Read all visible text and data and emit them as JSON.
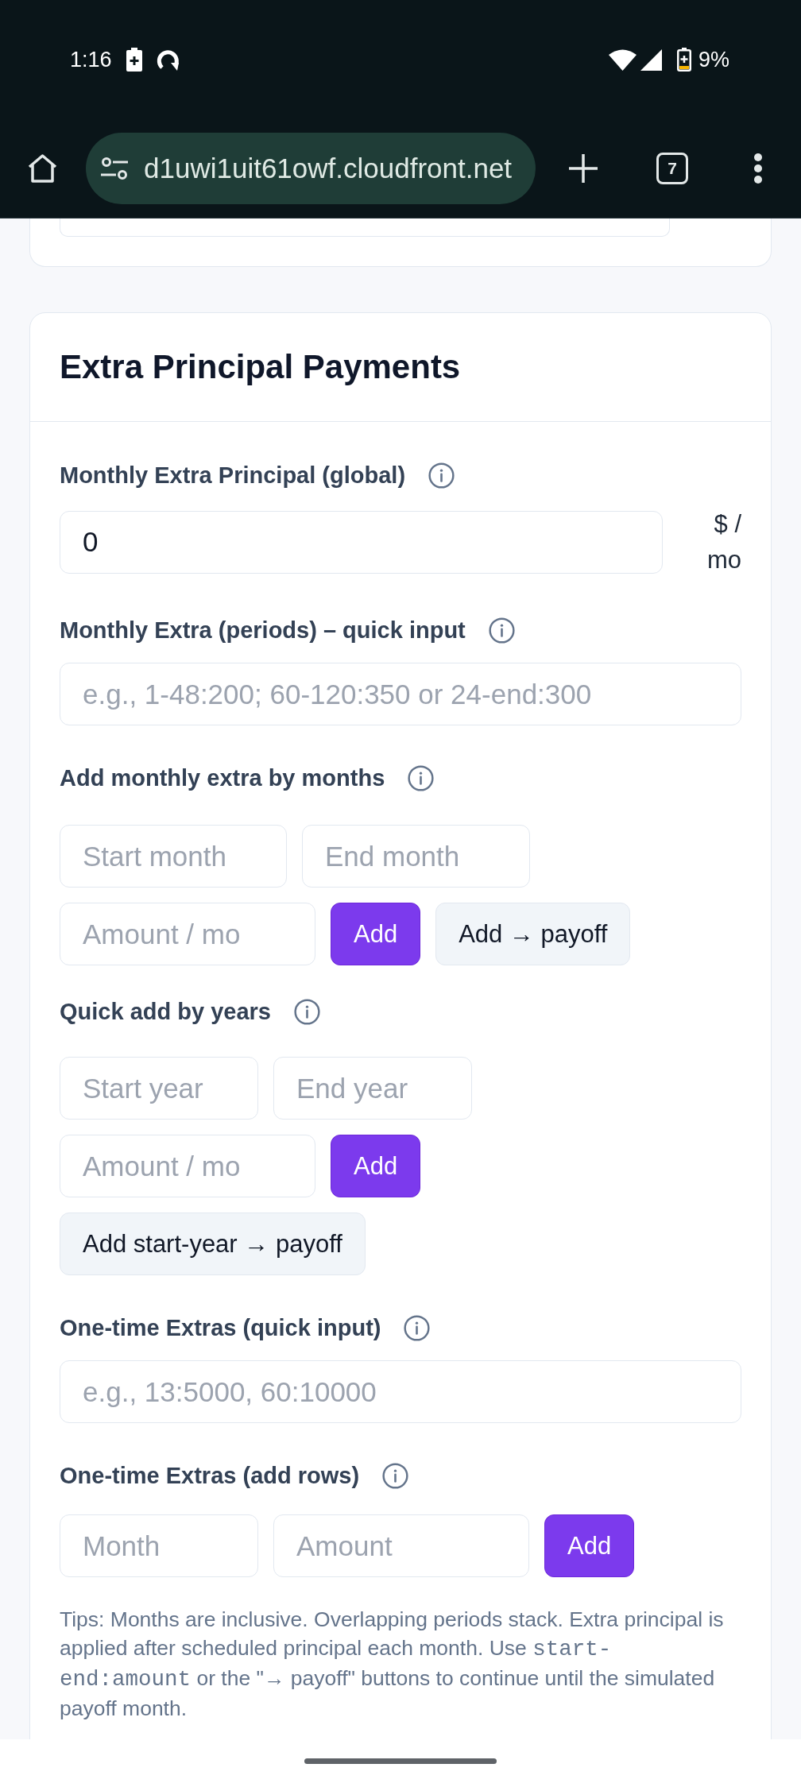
{
  "status_bar": {
    "time": "1:16",
    "battery": "9%"
  },
  "browser": {
    "url": "d1uwi1uit61owf.cloudfront.net",
    "tab_count": "7"
  },
  "card": {
    "title": "Extra Principal Payments",
    "sections": [
      {
        "kind": "unit_input",
        "label": "Monthly Extra Principal (global)",
        "value": "0",
        "unit": "$ / mo"
      },
      {
        "kind": "text_input",
        "label": "Monthly Extra (periods) – quick input",
        "placeholder": "e.g., 1-48:200; 60-120:350 or 24-end:300"
      },
      {
        "kind": "months",
        "label": "Add monthly extra by months",
        "rows": [
          {
            "controls": [
              {
                "kind": "input",
                "placeholder": "Start month"
              },
              {
                "kind": "input",
                "placeholder": "End month"
              }
            ]
          },
          {
            "controls": [
              {
                "kind": "input",
                "placeholder": "Amount / mo"
              },
              {
                "kind": "primary_button",
                "label": "Add"
              },
              {
                "kind": "secondary_button",
                "label": "Add → payoff"
              }
            ]
          }
        ]
      },
      {
        "kind": "years",
        "label": "Quick add by years",
        "rows": [
          {
            "controls": [
              {
                "kind": "input",
                "placeholder": "Start year"
              },
              {
                "kind": "input",
                "placeholder": "End year"
              }
            ]
          },
          {
            "controls": [
              {
                "kind": "input",
                "placeholder": "Amount / mo"
              },
              {
                "kind": "primary_button",
                "label": "Add"
              }
            ]
          },
          {
            "controls": [
              {
                "kind": "secondary_button",
                "label": "Add start-year → payoff"
              }
            ]
          }
        ]
      },
      {
        "kind": "text_input",
        "label": "One-time Extras (quick input)",
        "placeholder": "e.g., 13:5000, 60:10000"
      },
      {
        "kind": "rows",
        "label": "One-time Extras (add rows)",
        "rows": [
          {
            "controls": [
              {
                "kind": "input",
                "placeholder": "Month"
              },
              {
                "kind": "input",
                "placeholder": "Amount"
              },
              {
                "kind": "primary_button",
                "label": "Add"
              }
            ]
          }
        ]
      }
    ],
    "tips": [
      {
        "kind": "text",
        "text": "Tips: Months are inclusive. Overlapping periods stack. Extra principal is applied after scheduled principal each month. Use "
      },
      {
        "kind": "code",
        "text": "start-end:amount"
      },
      {
        "kind": "text",
        "text": " or the \"→ payoff\" buttons to continue until the simulated payoff month."
      }
    ]
  }
}
